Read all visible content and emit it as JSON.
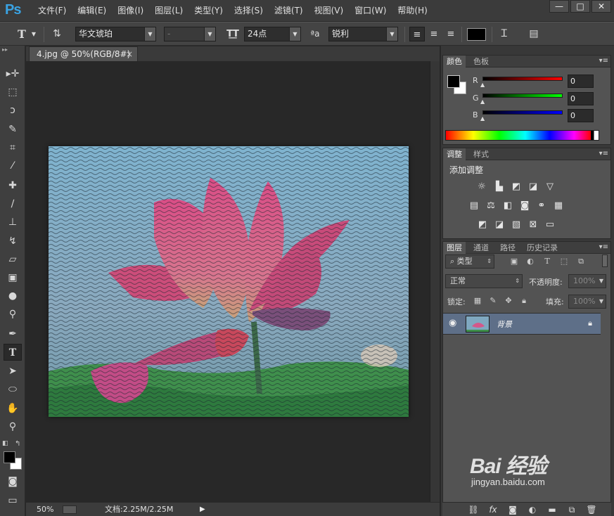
{
  "app": {
    "logo": "Ps",
    "menu": [
      "文件(F)",
      "编辑(E)",
      "图像(I)",
      "图层(L)",
      "类型(Y)",
      "选择(S)",
      "滤镜(T)",
      "视图(V)",
      "窗口(W)",
      "帮助(H)"
    ],
    "window_controls": [
      "—",
      "□",
      "✕"
    ]
  },
  "options": {
    "font_family": "华文琥珀",
    "font_style": "-",
    "font_size": "24点",
    "antialias": "锐利",
    "aa_label": "ªa",
    "text_color": "#000000"
  },
  "document": {
    "tab_title": "4.jpg @ 50%(RGB/8#) *",
    "close": "×",
    "zoom": "50%",
    "doc_size": "文档:2.25M/2.25M"
  },
  "color_panel": {
    "tabs": [
      "颜色",
      "色板"
    ],
    "channels": [
      {
        "label": "R",
        "value": "0",
        "color": "#ff0000"
      },
      {
        "label": "G",
        "value": "0",
        "color": "#00ff00"
      },
      {
        "label": "B",
        "value": "0",
        "color": "#0000ff"
      }
    ]
  },
  "adjustments_panel": {
    "tabs": [
      "调整",
      "样式"
    ],
    "title": "添加调整"
  },
  "layers_panel": {
    "tabs": [
      "图层",
      "通道",
      "路径",
      "历史记录"
    ],
    "filter_kind": "类型",
    "blend_mode": "正常",
    "opacity_label": "不透明度:",
    "opacity_value": "100%",
    "lock_label": "锁定:",
    "fill_label": "填充:",
    "fill_value": "100%",
    "layers": [
      {
        "name": "背景",
        "visible": true,
        "locked": true
      }
    ]
  },
  "watermark": {
    "brand": "Bai 经验",
    "url": "jingyan.baidu.com"
  }
}
